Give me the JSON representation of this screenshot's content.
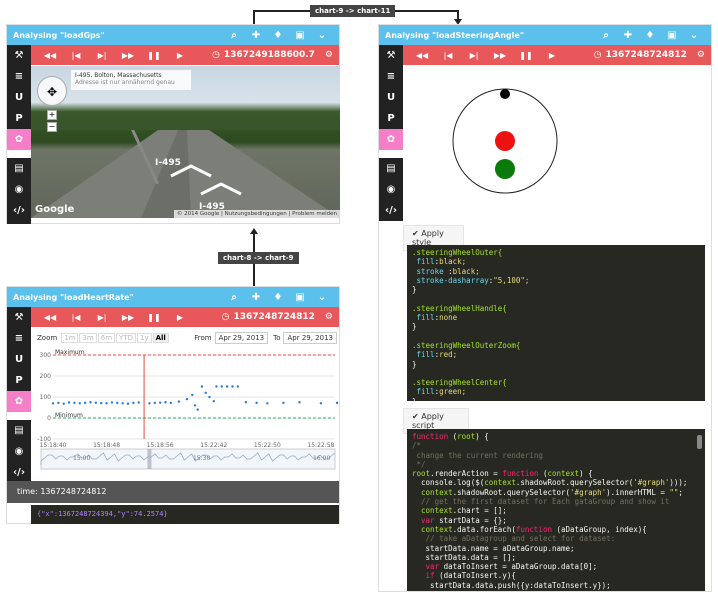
{
  "connectors": {
    "top": "chart-9 -> chart-11",
    "mid": "chart-8 -> chart-9"
  },
  "gps": {
    "title": "Analysing \"loadGps\"",
    "timestamp": "1367249188600.7",
    "map": {
      "location_line1": "I-495, Bolton, Massachusetts",
      "location_line2": "Adresse ist nur annähernd genau",
      "road_label_1": "I-495",
      "road_label_2": "I-495",
      "google": "Google",
      "footer": "© 2014 Google  |  Nutzungsbedingungen  |  Problem melden"
    }
  },
  "steering": {
    "title": "Analysing \"loadSteeringAngle\"",
    "timestamp": "1367248724812",
    "apply_style": "Apply style",
    "apply_script": "Apply script",
    "css": [
      ".steeringWheelOuter{",
      " fill:black;",
      " stroke :black;",
      " stroke-dasharray:\"5,100\";",
      "}",
      "",
      ".steeringWheelHandle{",
      " fill:none",
      "}",
      "",
      ".steeringWheelOuterZoom{",
      " fill:red;",
      "}",
      "",
      ".steeringWheelCenter{",
      " fill:green;",
      "}"
    ],
    "script": [
      "function (root) {",
      "/*",
      " change the current rendering",
      " */",
      "root.renderAction = function (context) {",
      "  console.log($(context.shadowRoot.querySelector('#graph')));",
      "  context.shadowRoot.querySelector('#graph').innerHTML = \"\";",
      "  // get the first dataset for Each gataGroup and show it",
      "  context.chart = [];",
      "  var startData = {};",
      "  context.data.forEach(function (aDataGroup, index){",
      "   // take aDatagroup and select for dataset:",
      "   startData.name = aDataGroup.name;",
      "   startData.data = [];",
      "   var dataToInsert = aDataGroup.data[0];",
      "   if (dataToInsert.y){",
      "    startData.data.push({y:dataToInsert.y});",
      "   }"
    ]
  },
  "heart": {
    "title": "Analysing \"loadHeartRate\"",
    "timestamp": "1367248724812",
    "zoom_label": "Zoom",
    "zoom_buttons": [
      "1m",
      "3m",
      "6m",
      "YTD",
      "1y",
      "All"
    ],
    "from_label": "From",
    "from_date": "Apr 29, 2013",
    "to_label": "To",
    "to_date": "Apr 29, 2013",
    "nav_labels": [
      "15:00",
      "15:30",
      "16:00"
    ],
    "time_text": "time: 1367248724812",
    "json_text": "{\"x\":1367248724394,\"y\":74.2574}"
  },
  "chart_data": {
    "type": "scatter",
    "title": "",
    "xlabel": "",
    "ylabel": "",
    "x_ticks": [
      "15:18:40",
      "15:18:48",
      "15:18:56",
      "15:22:42",
      "15:22:50",
      "15:22:58"
    ],
    "y_ticks": [
      300,
      200,
      100,
      0,
      -100
    ],
    "ylim": [
      -100,
      300
    ],
    "reference_lines": [
      {
        "name": "Maximum",
        "y": 300,
        "color": "#e74c3c"
      },
      {
        "name": "Minimum",
        "y": 0,
        "color": "#27ae60"
      }
    ],
    "cursor_x_index": 1.7,
    "series": [
      {
        "values": [
          {
            "x": 0.0,
            "y": 70
          },
          {
            "x": 0.1,
            "y": 72
          },
          {
            "x": 0.2,
            "y": 68
          },
          {
            "x": 0.3,
            "y": 74
          },
          {
            "x": 0.4,
            "y": 72
          },
          {
            "x": 0.5,
            "y": 70
          },
          {
            "x": 0.6,
            "y": 72
          },
          {
            "x": 0.7,
            "y": 75
          },
          {
            "x": 0.8,
            "y": 73
          },
          {
            "x": 0.9,
            "y": 71
          },
          {
            "x": 1.0,
            "y": 70
          },
          {
            "x": 1.1,
            "y": 74
          },
          {
            "x": 1.2,
            "y": 72
          },
          {
            "x": 1.3,
            "y": 70
          },
          {
            "x": 1.4,
            "y": 68
          },
          {
            "x": 1.5,
            "y": 72
          },
          {
            "x": 1.6,
            "y": 74
          },
          {
            "x": 1.8,
            "y": 70
          },
          {
            "x": 1.9,
            "y": 72
          },
          {
            "x": 2.0,
            "y": 73
          },
          {
            "x": 2.1,
            "y": 75
          },
          {
            "x": 2.2,
            "y": 72
          },
          {
            "x": 2.35,
            "y": 78
          },
          {
            "x": 2.5,
            "y": 90
          },
          {
            "x": 2.6,
            "y": 110
          },
          {
            "x": 2.65,
            "y": 60
          },
          {
            "x": 2.7,
            "y": 40
          },
          {
            "x": 2.78,
            "y": 150
          },
          {
            "x": 2.85,
            "y": 120
          },
          {
            "x": 2.92,
            "y": 100
          },
          {
            "x": 3.0,
            "y": 80
          },
          {
            "x": 3.05,
            "y": 150
          },
          {
            "x": 3.15,
            "y": 150
          },
          {
            "x": 3.25,
            "y": 150
          },
          {
            "x": 3.35,
            "y": 150
          },
          {
            "x": 3.45,
            "y": 150
          },
          {
            "x": 3.6,
            "y": 75
          },
          {
            "x": 3.8,
            "y": 72
          },
          {
            "x": 4.0,
            "y": 70
          },
          {
            "x": 4.3,
            "y": 72
          },
          {
            "x": 4.6,
            "y": 75
          },
          {
            "x": 5.0,
            "y": 70
          },
          {
            "x": 5.3,
            "y": 72
          },
          {
            "x": 5.6,
            "y": 73
          },
          {
            "x": 5.9,
            "y": 74
          },
          {
            "x": 6.2,
            "y": 72
          },
          {
            "x": 6.5,
            "y": 70
          },
          {
            "x": 6.8,
            "y": 74
          },
          {
            "x": 7.1,
            "y": 72
          },
          {
            "x": 7.4,
            "y": 75
          },
          {
            "x": 7.7,
            "y": 73
          }
        ]
      }
    ]
  }
}
